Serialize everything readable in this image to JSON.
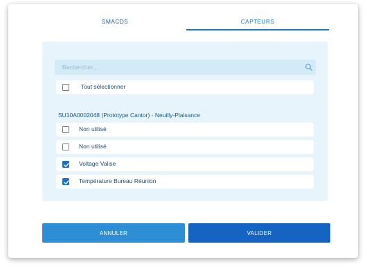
{
  "tabs": [
    {
      "label": "SMACDS",
      "active": false
    },
    {
      "label": "CAPTEURS",
      "active": true
    }
  ],
  "search": {
    "placeholder": "Rechercher..."
  },
  "select_all": {
    "label": "Tout sélectionner",
    "checked": false
  },
  "group": {
    "title": "SU10A0002048 (Prototype Cantor) - Neuilly-Plaisance",
    "items": [
      {
        "label": "Non utilisé",
        "checked": false
      },
      {
        "label": "Non utilisé",
        "checked": false
      },
      {
        "label": "Voltage Valise",
        "checked": true
      },
      {
        "label": "Température Bureau Réunion",
        "checked": true
      }
    ]
  },
  "buttons": {
    "cancel": "ANNULER",
    "confirm": "VALIDER"
  },
  "colors": {
    "accent": "#1a73c0",
    "panel": "#e8f4fb",
    "cancel": "#2d8ed6",
    "confirm": "#1564c4"
  },
  "icons": {
    "search": "search-icon",
    "check": "check-icon"
  }
}
